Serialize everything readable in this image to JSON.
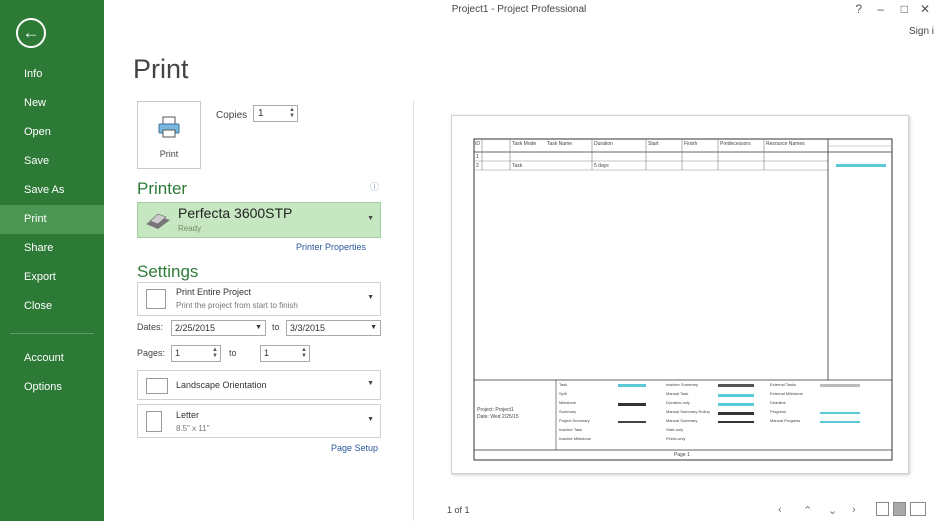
{
  "window": {
    "title": "Project1 - Project Professional",
    "help": "?",
    "minimize": "–",
    "restore": "□",
    "close": "✕",
    "signin": "Sign i"
  },
  "sidebar": {
    "back_icon": "arrow-left-icon",
    "items": [
      {
        "label": "Info"
      },
      {
        "label": "New"
      },
      {
        "label": "Open"
      },
      {
        "label": "Save"
      },
      {
        "label": "Save As"
      },
      {
        "label": "Print",
        "active": true
      },
      {
        "label": "Share"
      },
      {
        "label": "Export"
      },
      {
        "label": "Close"
      }
    ],
    "bottom_items": [
      {
        "label": "Account"
      },
      {
        "label": "Options"
      }
    ]
  },
  "print": {
    "heading": "Print",
    "button_label": "Print",
    "copies_label": "Copies",
    "copies_value": "1"
  },
  "printer": {
    "heading": "Printer",
    "name": "Perfecta 3600STP",
    "status": "Ready",
    "properties_link": "Printer Properties"
  },
  "settings": {
    "heading": "Settings",
    "range_title": "Print Entire Project",
    "range_desc": "Print the project from start to finish",
    "dates_label": "Dates:",
    "date_from": "2/25/2015",
    "to_label": "to",
    "date_to": "3/3/2015",
    "pages_label": "Pages:",
    "page_from": "1",
    "pages_to_label": "to",
    "page_to": "1",
    "orientation": "Landscape Orientation",
    "paper_name": "Letter",
    "paper_size": "8.5\" x 11\"",
    "page_setup_link": "Page Setup"
  },
  "preview": {
    "table_headers": [
      "ID",
      "Task Mode",
      "Task Name",
      "Duration",
      "Start",
      "Finish",
      "Predecessors",
      "Resource Names"
    ],
    "rows": [
      {
        "id": "1",
        "name": "",
        "duration": ""
      },
      {
        "id": "2",
        "name": "Task",
        "duration": "5 days"
      }
    ],
    "footer_project": "Project: Project1",
    "footer_date": "Date: Wed 2/25/15",
    "legend_left": [
      "Task",
      "Split",
      "Milestone",
      "Summary",
      "Project Summary",
      "Inactive Task",
      "Inactive Milestone"
    ],
    "legend_mid": [
      "Inactive Summary",
      "Manual Task",
      "Duration-only",
      "Manual Summary Rollup",
      "Manual Summary",
      "Start-only",
      "Finish-only"
    ],
    "legend_right": [
      "External Tasks",
      "External Milestone",
      "Deadline",
      "Progress",
      "Manual Progress"
    ],
    "page_label": "Page 1",
    "page_counter": "1 of 1"
  },
  "colors": {
    "sidebar": "#2d7a37",
    "accent": "#2d7a37",
    "printer_bg": "#c6e7c2",
    "bar": "#5bc8d8"
  }
}
